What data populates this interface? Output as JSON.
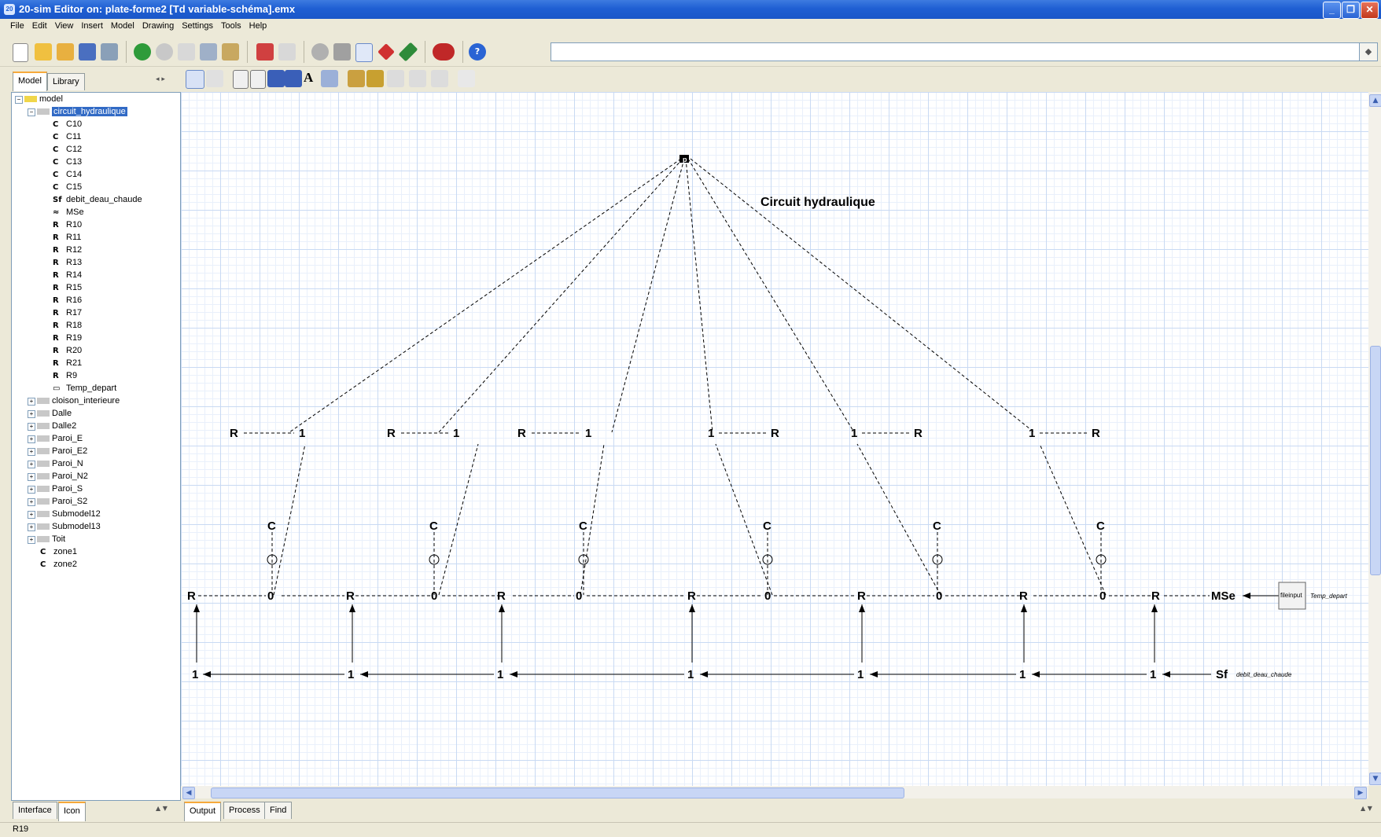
{
  "window": {
    "title": "20-sim Editor on: plate-forme2 [Td variable-schéma].emx"
  },
  "menu": [
    "File",
    "Edit",
    "View",
    "Insert",
    "Model",
    "Drawing",
    "Settings",
    "Tools",
    "Help"
  ],
  "left_tabs": [
    "Model",
    "Library"
  ],
  "tree": {
    "root": "model",
    "selected": "circuit_hydraulique",
    "children": [
      {
        "icon": "C",
        "label": "C10"
      },
      {
        "icon": "C",
        "label": "C11"
      },
      {
        "icon": "C",
        "label": "C12"
      },
      {
        "icon": "C",
        "label": "C13"
      },
      {
        "icon": "C",
        "label": "C14"
      },
      {
        "icon": "C",
        "label": "C15"
      },
      {
        "icon": "Sf",
        "label": "debit_deau_chaude"
      },
      {
        "icon": "≈",
        "label": "MSe"
      },
      {
        "icon": "R",
        "label": "R10"
      },
      {
        "icon": "R",
        "label": "R11"
      },
      {
        "icon": "R",
        "label": "R12"
      },
      {
        "icon": "R",
        "label": "R13"
      },
      {
        "icon": "R",
        "label": "R14"
      },
      {
        "icon": "R",
        "label": "R15"
      },
      {
        "icon": "R",
        "label": "R16"
      },
      {
        "icon": "R",
        "label": "R17"
      },
      {
        "icon": "R",
        "label": "R18"
      },
      {
        "icon": "R",
        "label": "R19"
      },
      {
        "icon": "R",
        "label": "R20"
      },
      {
        "icon": "R",
        "label": "R21"
      },
      {
        "icon": "R",
        "label": "R9"
      },
      {
        "icon": "▭",
        "label": "Temp_depart"
      }
    ],
    "submodels": [
      "cloison_interieure",
      "Dalle",
      "Dalle2",
      "Paroi_E",
      "Paroi_E2",
      "Paroi_N",
      "Paroi_N2",
      "Paroi_S",
      "Paroi_S2",
      "Submodel12",
      "Submodel13",
      "Toit"
    ],
    "extras": [
      {
        "icon": "C",
        "label": "zone1"
      },
      {
        "icon": "C",
        "label": "zone2"
      }
    ]
  },
  "diagram": {
    "title": "Circuit hydraulique",
    "top_label": "p",
    "r": "R",
    "one": "1",
    "zero": "0",
    "c": "C",
    "mse": "MSe",
    "sf": "Sf",
    "fileinput": "fileinput",
    "temp_label": "Temp_depart",
    "debit_label": "debit_deau_chaude"
  },
  "bottom_left_tabs": [
    "Interface",
    "Icon"
  ],
  "bottom_tabs": [
    "Output",
    "Process",
    "Find"
  ],
  "status": {
    "text": "R19"
  },
  "colors": {
    "titlebar": "#1f5fd3",
    "selection": "#316ac5",
    "grid": "#c9daf3"
  }
}
